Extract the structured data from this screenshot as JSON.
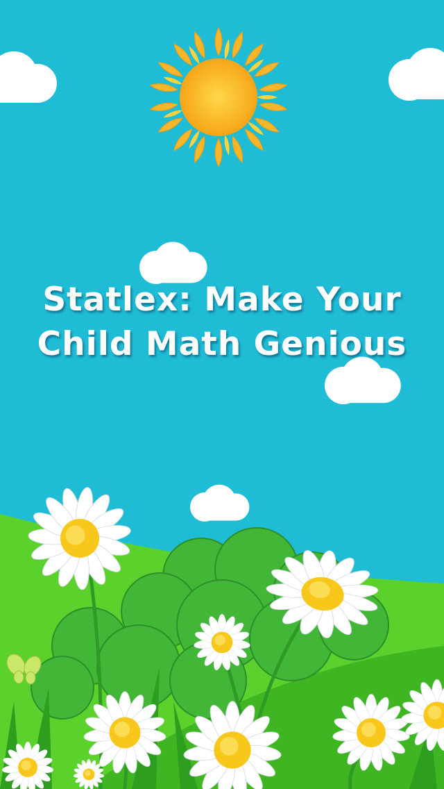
{
  "splash": {
    "title_line1": "Statlex: Make Your",
    "title_line2": "Child Math Genious"
  },
  "colors": {
    "sky": "#1fbcd6",
    "sun": "#fbb724",
    "grass": "#55c82a",
    "bush": "#3db43a",
    "cloud": "#ffffff",
    "title": "#ffffff"
  },
  "icons": [
    "sun-icon",
    "cloud-icon",
    "daisy-icon",
    "butterfly-icon",
    "bush-icon"
  ]
}
